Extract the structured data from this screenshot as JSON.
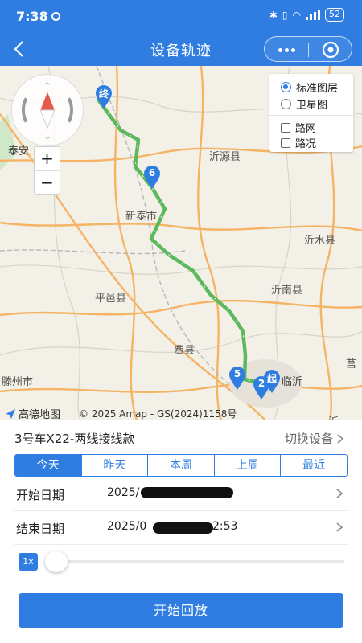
{
  "status_bar": {
    "time": "7:38",
    "battery": "52"
  },
  "header": {
    "title": "设备轨迹",
    "back_icon": "chevron-left-icon",
    "more_icon": "more-dots-icon",
    "target_icon": "target-icon"
  },
  "map": {
    "layers": {
      "standard": "标准图层",
      "satellite": "卫星图",
      "roads": "路网",
      "traffic": "路况",
      "selected": "standard"
    },
    "zoom": {
      "in": "+",
      "out": "−"
    },
    "places": [
      "泰安",
      "沂源县",
      "新泰市",
      "沂水县",
      "沂南县",
      "平邑县",
      "费县",
      "滕州市",
      "临沂",
      "莒",
      "沂"
    ],
    "markers": {
      "end": "终",
      "p6": "6",
      "p5": "5",
      "p2": "2",
      "start": "起"
    },
    "logo": "高德地图",
    "copyright": "© 2025 Amap - GS(2024)1158号",
    "route_color": "#5cb85c",
    "marker_color": "#2f7de1"
  },
  "device": {
    "name": "3号车X22-两线接线款",
    "switch_label": "切换设备"
  },
  "tabs": [
    "今天",
    "昨天",
    "本周",
    "上周",
    "最近"
  ],
  "active_tab": "今天",
  "dates": {
    "start_label": "开始日期",
    "start_value": "2025/",
    "end_label": "结束日期",
    "end_value": "2025/0",
    "end_value_tail": "2:53"
  },
  "playback": {
    "speed": "1x",
    "progress": 0
  },
  "play_button": "开始回放"
}
